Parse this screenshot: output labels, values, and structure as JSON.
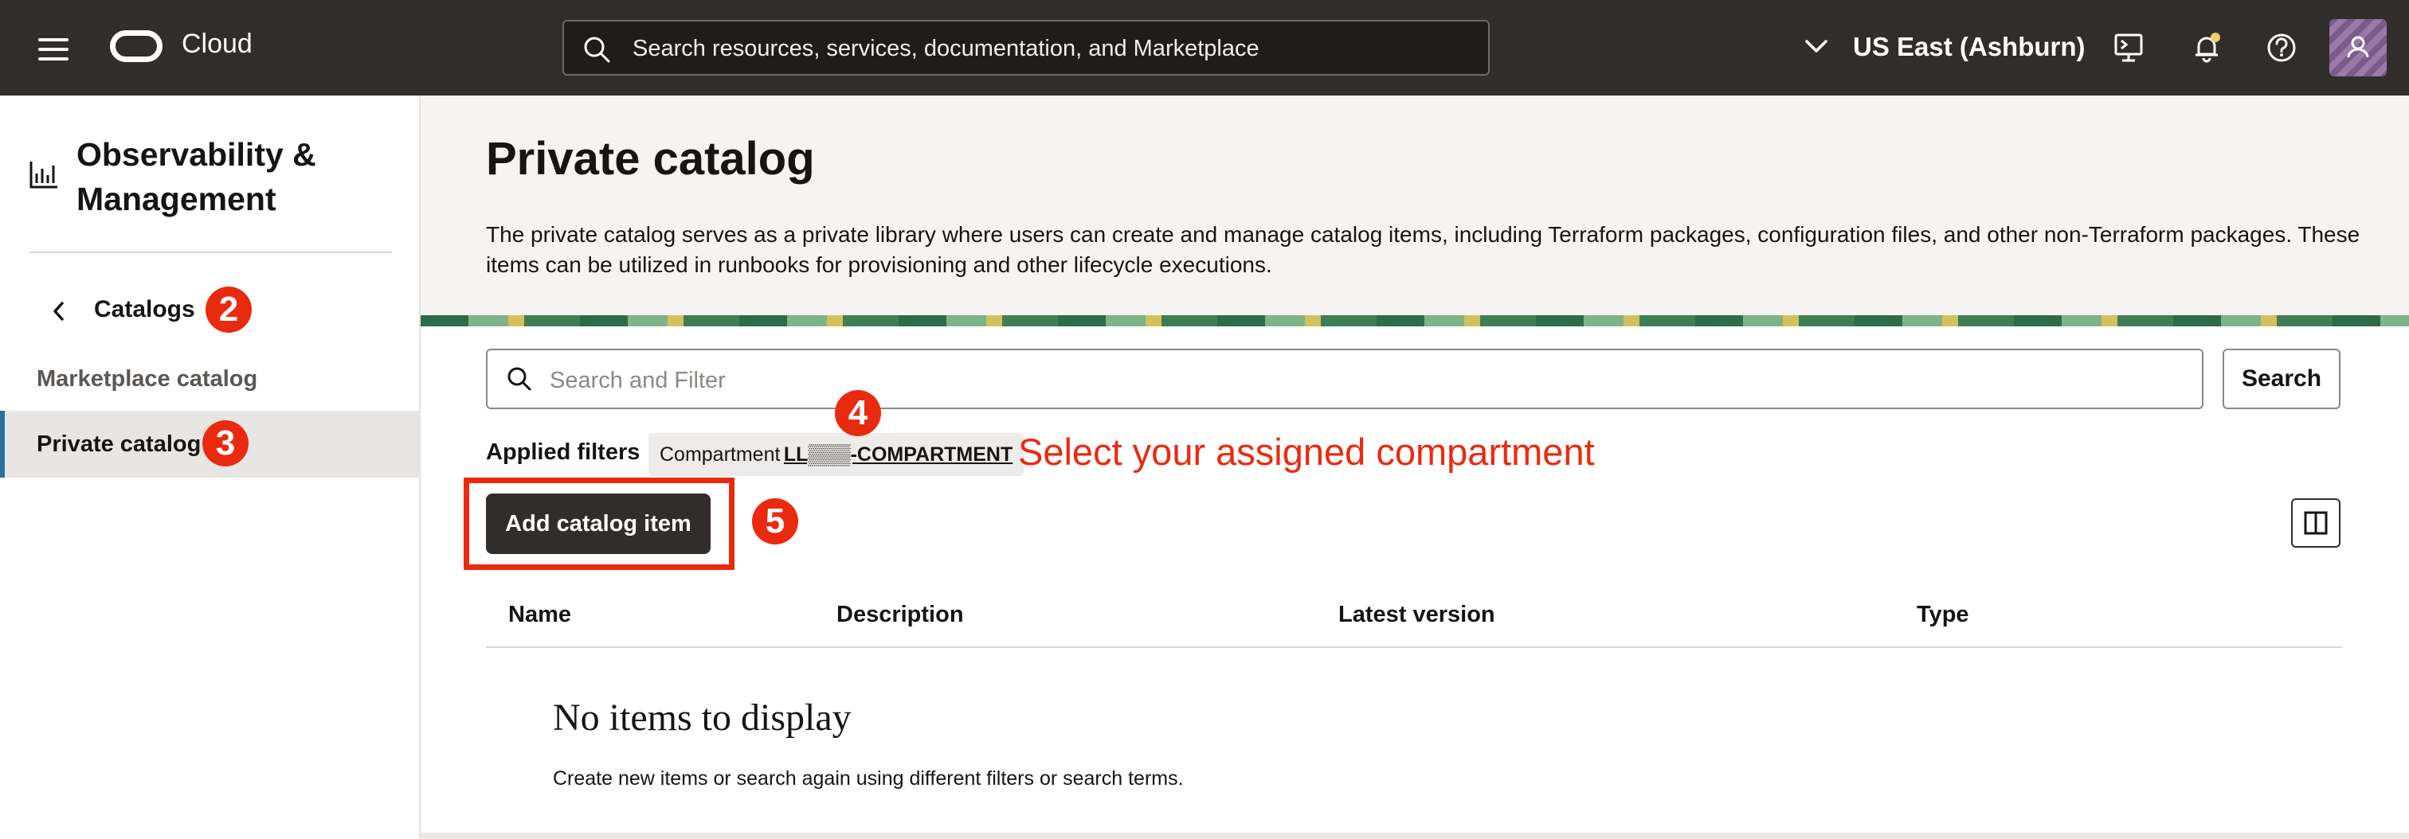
{
  "topbar": {
    "brand": "Cloud",
    "search_placeholder": "Search resources, services, documentation, and Marketplace",
    "region": "US East (Ashburn)"
  },
  "sidebar": {
    "service_title": "Observability & Management",
    "back_label": "Catalogs",
    "items": [
      {
        "label": "Marketplace catalog"
      },
      {
        "label": "Private catalog",
        "selected": true
      }
    ]
  },
  "main": {
    "title": "Private catalog",
    "description": "The private catalog serves as a private library where users can create and manage catalog items, including Terraform packages, configuration files, and other non-Terraform packages. These items can be utilized in runbooks for provisioning and other lifecycle executions.",
    "filter_placeholder": "Search and Filter",
    "search_button": "Search",
    "applied_filters_label": "Applied filters",
    "filter_chip": {
      "key": "Compartment",
      "value": "LL▒▒▒-COMPARTMENT"
    },
    "add_button": "Add catalog item",
    "table": {
      "columns": [
        "Name",
        "Description",
        "Latest version",
        "Type"
      ],
      "rows": []
    },
    "empty_title": "No items to display",
    "empty_desc": "Create new items or search again using different filters or search terms."
  },
  "annotations": {
    "badges": [
      "2",
      "3",
      "4",
      "5"
    ],
    "compartment_note": "Select your assigned compartment",
    "color": "#ea2a0f"
  },
  "colors": {
    "topbar": "#312d2a",
    "header_band": "#f5f4f2",
    "selected_nav": "#e8e6e3"
  }
}
